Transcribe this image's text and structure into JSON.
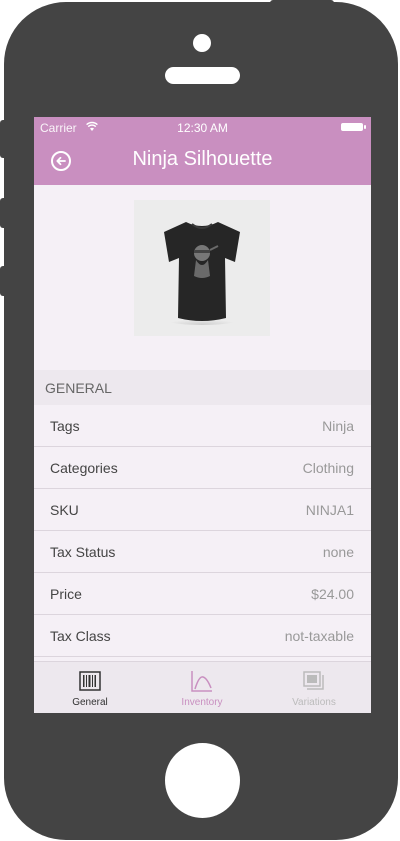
{
  "status_bar": {
    "carrier": "Carrier",
    "time": "12:30 AM"
  },
  "header": {
    "title": "Ninja Silhouette",
    "back_icon": "back-arrow-circle-icon",
    "color": "#c98fc0"
  },
  "product": {
    "image": "black-tshirt-ninja-graphic"
  },
  "section": {
    "title": "GENERAL"
  },
  "rows": [
    {
      "label": "Tags",
      "value": "Ninja"
    },
    {
      "label": "Categories",
      "value": "Clothing"
    },
    {
      "label": "SKU",
      "value": "NINJA1"
    },
    {
      "label": "Tax Status",
      "value": "none"
    },
    {
      "label": "Price",
      "value": "$24.00"
    },
    {
      "label": "Tax Class",
      "value": "not-taxable"
    }
  ],
  "tabs": [
    {
      "label": "General",
      "icon": "barcode-icon",
      "color": "#333333",
      "active": true
    },
    {
      "label": "Inventory",
      "icon": "chart-line-icon",
      "color": "#c98fc0",
      "active": false
    },
    {
      "label": "Variations",
      "icon": "stack-icon",
      "color": "#bbbbbb",
      "active": false
    }
  ]
}
